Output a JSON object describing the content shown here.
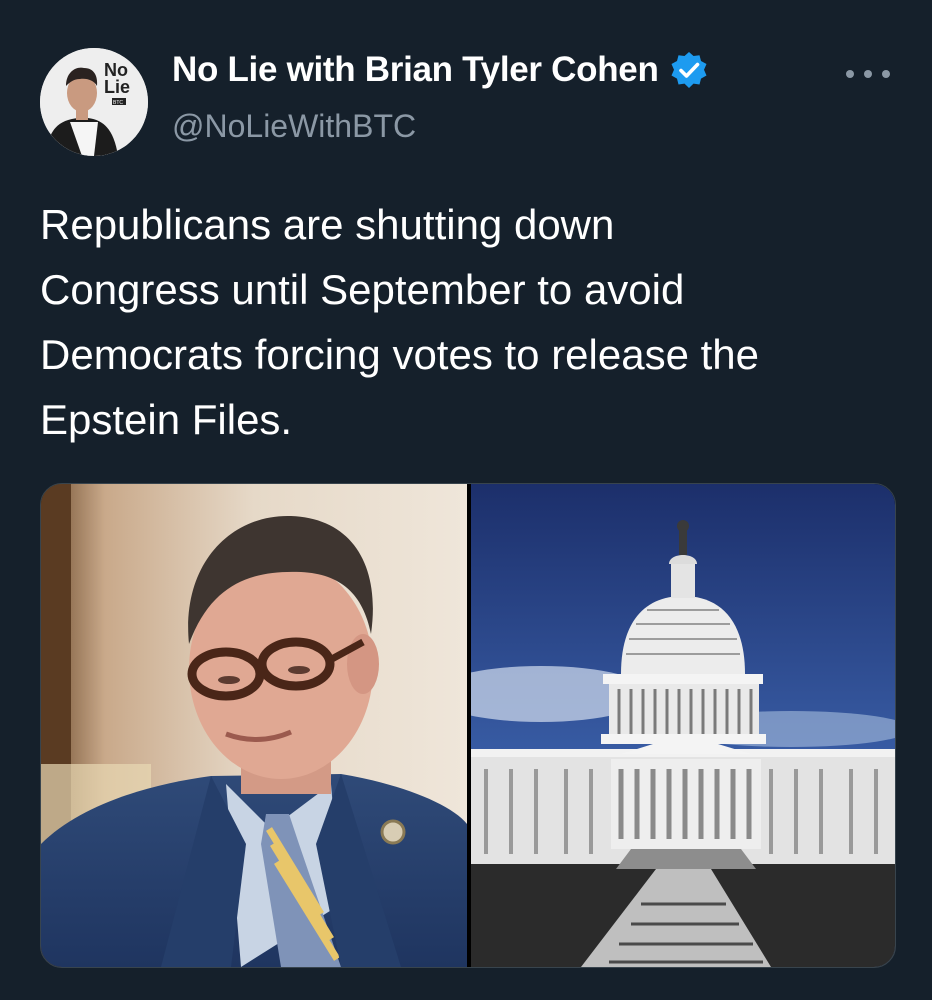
{
  "author": {
    "display_name": "No Lie with Brian Tyler Cohen",
    "handle": "@NoLieWithBTC",
    "avatar_icon": "avatar-photo",
    "avatar_logo_text": [
      "No",
      "Lie",
      "BTC"
    ],
    "verified_icon": "verified-badge-icon",
    "verified_color": "#1d9bf0"
  },
  "menu": {
    "icon": "more-options-icon"
  },
  "tweet": {
    "lines": [
      "Republicans are shutting down",
      "Congress until September to avoid",
      "Democrats forcing votes to release the",
      "Epstein Files."
    ]
  },
  "media": {
    "left_image": "photo-of-man-in-suit",
    "right_image": "photo-of-us-capitol-building"
  },
  "colors": {
    "background": "#15202b",
    "text": "#ffffff",
    "secondary_text": "#8b98a5"
  }
}
